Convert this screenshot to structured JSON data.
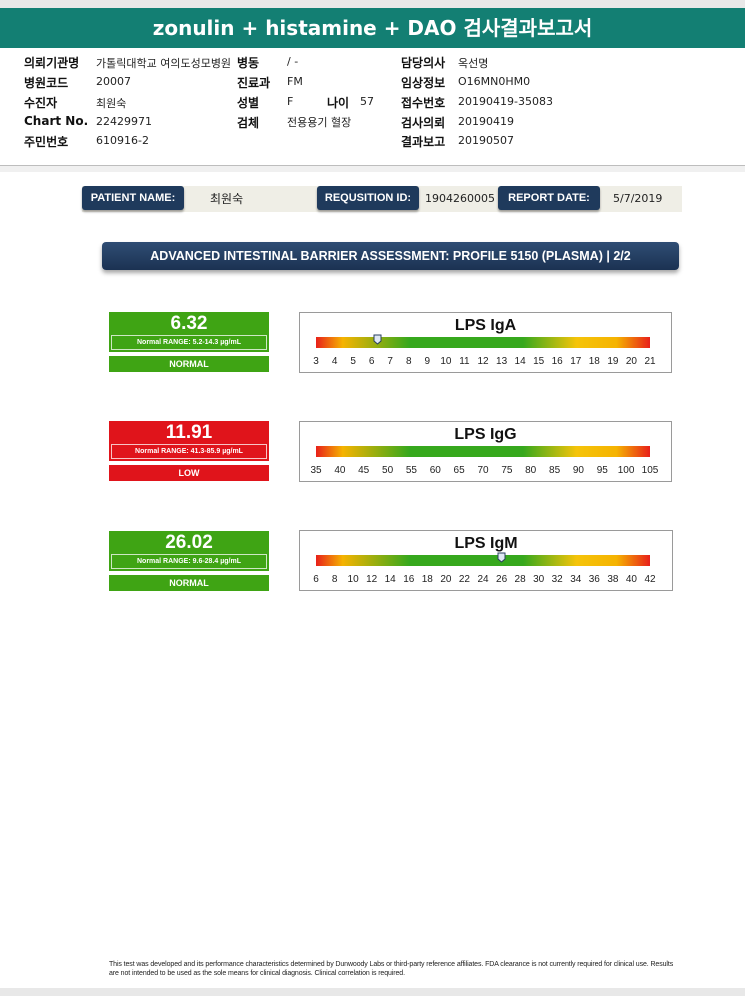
{
  "header": {
    "title": "zonulin + histamine + DAO 검사결과보고서"
  },
  "info": {
    "hospital_label": "의뢰기관명",
    "hospital_value": "가톨릭대학교 여의도성모병원",
    "ward_label": "병동",
    "ward_value": "/ -",
    "doctor_label": "담당의사",
    "doctor_value": "옥선명",
    "code_label": "병원코드",
    "code_value": "20007",
    "dept_label": "진료과",
    "dept_value": "FM",
    "clinical_label": "임상정보",
    "clinical_value": "O16MN0HM0",
    "patient_label": "수진자",
    "patient_value": "최원숙",
    "sex_label": "성별",
    "sex_value": "F",
    "age_label": "나이",
    "age_value": "57",
    "accession_label": "접수번호",
    "accession_value": "20190419-35083",
    "chart_label": "Chart No.",
    "chart_value": "22429971",
    "specimen_label": "검체",
    "specimen_value": "전용용기 혈장",
    "request_label": "검사의뢰",
    "request_value": "20190419",
    "id_label": "주민번호",
    "id_value": "610916-2",
    "report_label": "결과보고",
    "report_value": "20190507"
  },
  "patient_bar": {
    "name_label": "PATIENT NAME:",
    "name_value": "최원숙",
    "req_label": "REQUSITION ID:",
    "req_value": "1904260005",
    "date_label": "REPORT DATE:",
    "date_value": "5/7/2019"
  },
  "banner": {
    "title": "ADVANCED INTESTINAL BARRIER ASSESSMENT: PROFILE 5150 (PLASMA) | 2/2"
  },
  "results": [
    {
      "value": "6.32",
      "range": "Normal RANGE: 5.2-14.3 µg/mL",
      "status": "NORMAL",
      "status_color": "#3fa414",
      "gauge_title": "LPS IgA",
      "ticks": [
        "3",
        "4",
        "5",
        "6",
        "7",
        "8",
        "9",
        "10",
        "11",
        "12",
        "13",
        "14",
        "15",
        "16",
        "17",
        "18",
        "19",
        "20",
        "21"
      ],
      "marker_value": 6.32
    },
    {
      "value": "11.91",
      "range": "Normal RANGE: 41.3-85.9 µg/mL",
      "status": "LOW",
      "status_color": "#e0141b",
      "gauge_title": "LPS IgG",
      "ticks": [
        "35",
        "40",
        "45",
        "50",
        "55",
        "60",
        "65",
        "70",
        "75",
        "80",
        "85",
        "90",
        "95",
        "100",
        "105"
      ],
      "marker_value": null
    },
    {
      "value": "26.02",
      "range": "Normal RANGE: 9.6-28.4 µg/mL",
      "status": "NORMAL",
      "status_color": "#3fa414",
      "gauge_title": "LPS IgM",
      "ticks": [
        "6",
        "8",
        "10",
        "12",
        "14",
        "16",
        "18",
        "20",
        "22",
        "24",
        "26",
        "28",
        "30",
        "32",
        "34",
        "36",
        "38",
        "40",
        "42"
      ],
      "marker_value": 26.02
    }
  ],
  "footnote": "This test was developed and its performance characteristics determined by Dunwoody Labs or third-party reference affiliates. FDA clearance is not currently required for clinical use. Results are not intended to be used as the sole means for clinical diagnosis. Clinical correlation is required."
}
